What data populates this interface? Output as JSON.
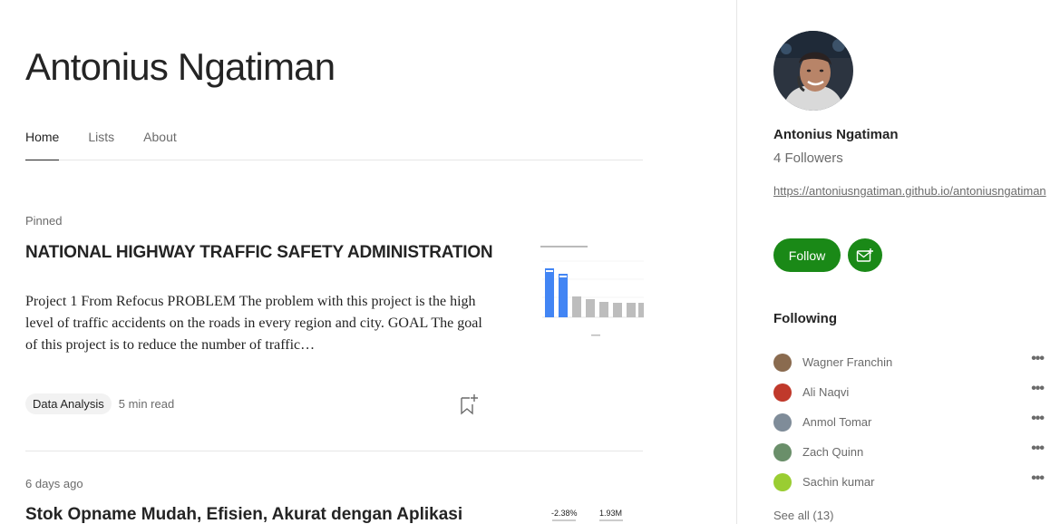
{
  "profile": {
    "name": "Antonius Ngatiman"
  },
  "tabs": [
    {
      "label": "Home"
    },
    {
      "label": "Lists"
    },
    {
      "label": "About"
    }
  ],
  "posts": [
    {
      "label": "Pinned",
      "title": "NATIONAL HIGHWAY TRAFFIC SAFETY ADMINISTRATION",
      "excerpt": "Project 1 From Refocus PROBLEM The problem with this project is the high level of traffic accidents on the roads in every region and city. GOAL The goal of this project is to reduce the number of traffic…",
      "tag": "Data Analysis",
      "read_time": "5 min read",
      "thumbnail_icon": "bar-chart-thumbnail"
    },
    {
      "label": "6 days ago",
      "title": "Stok Opname Mudah, Efisien, Akurat dengan Aplikasi",
      "stats": [
        "-2.38%",
        "1.93M"
      ]
    }
  ],
  "sidebar": {
    "name": "Antonius Ngatiman",
    "followers": "4 Followers",
    "link": "https://antoniusngatiman.github.io/antoniusngatiman",
    "follow_label": "Follow",
    "following_heading": "Following",
    "following": [
      {
        "name": "Wagner Franchin",
        "color": "#8a6b4f"
      },
      {
        "name": "Ali Naqvi",
        "color": "#c0392b"
      },
      {
        "name": "Anmol Tomar",
        "color": "#7f8c99"
      },
      {
        "name": "Zach Quinn",
        "color": "#6a8f6a"
      },
      {
        "name": "Sachin kumar",
        "color": "#9acd32"
      }
    ],
    "see_all": "See all (13)"
  },
  "colors": {
    "accent": "#1a8917",
    "text": "#242424",
    "muted": "#6b6b6b"
  }
}
